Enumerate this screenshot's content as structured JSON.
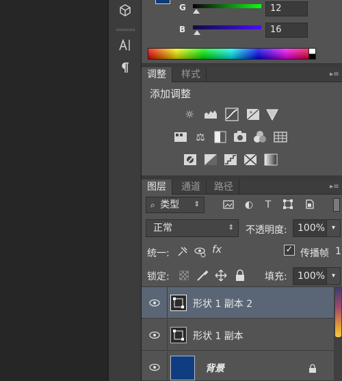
{
  "color_panel": {
    "g_label": "G",
    "g_value": "12",
    "b_label": "B",
    "b_value": "16",
    "swatch_color": "#0f3a7a"
  },
  "adjustments_panel": {
    "tabs": [
      "调整",
      "样式"
    ],
    "title": "添加调整"
  },
  "layers_panel": {
    "tabs": [
      "图层",
      "通道",
      "路径"
    ],
    "filter_type": "类型",
    "blend_mode": "正常",
    "opacity_label": "不透明度:",
    "opacity_value": "100%",
    "unify_label": "统一:",
    "propagate_label": "传播帧",
    "propagate_value": "1",
    "lock_label": "锁定:",
    "fill_label": "填充:",
    "fill_value": "100%",
    "layers": [
      {
        "name": "形状 1 副本 2",
        "selected": true
      },
      {
        "name": "形状 1 副本",
        "selected": false
      },
      {
        "name": "背景",
        "selected": false
      }
    ]
  },
  "colors": {
    "panel_bg": "#535353",
    "selected_row": "#5a6675",
    "background_thumb": "#0f3d82"
  }
}
